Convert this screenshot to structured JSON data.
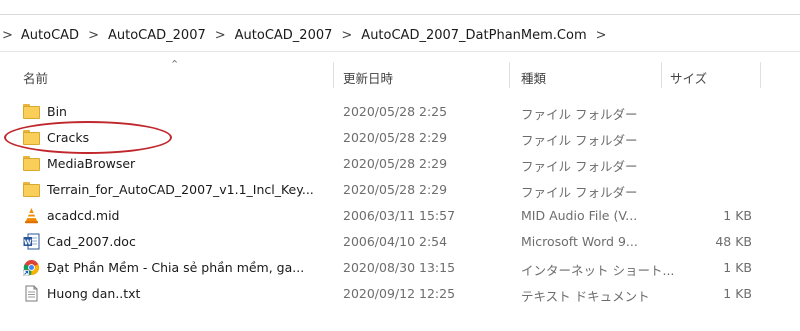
{
  "breadcrumb": {
    "items": [
      "AutoCAD",
      "AutoCAD_2007",
      "AutoCAD_2007",
      "AutoCAD_2007_DatPhanMem.Com"
    ]
  },
  "columns": {
    "name": "名前",
    "date": "更新日時",
    "type": "種類",
    "size": "サイズ"
  },
  "files": [
    {
      "name": "Bin",
      "date": "2020/05/28 2:25",
      "type": "ファイル フォルダー",
      "size": "",
      "icon": "folder-icon"
    },
    {
      "name": "Cracks",
      "date": "2020/05/28 2:29",
      "type": "ファイル フォルダー",
      "size": "",
      "icon": "folder-icon"
    },
    {
      "name": "MediaBrowser",
      "date": "2020/05/28 2:29",
      "type": "ファイル フォルダー",
      "size": "",
      "icon": "folder-icon"
    },
    {
      "name": "Terrain_for_AutoCAD_2007_v1.1_Incl_Key...",
      "date": "2020/05/28 2:29",
      "type": "ファイル フォルダー",
      "size": "",
      "icon": "folder-icon"
    },
    {
      "name": "acadcd.mid",
      "date": "2006/03/11 15:57",
      "type": "MID Audio File (V...",
      "size": "1 KB",
      "icon": "vlc-cone-icon"
    },
    {
      "name": "Cad_2007.doc",
      "date": "2006/04/10 2:54",
      "type": "Microsoft Word 9...",
      "size": "48 KB",
      "icon": "word-document-icon"
    },
    {
      "name": "Đạt Phần Mềm - Chia sẻ phần mềm, ga...",
      "date": "2020/08/30 13:15",
      "type": "インターネット ショート...",
      "size": "1 KB",
      "icon": "chrome-shortcut-icon"
    },
    {
      "name": "Huong dan..txt",
      "date": "2020/09/12 12:25",
      "type": "テキスト ドキュメント",
      "size": "1 KB",
      "icon": "text-file-icon"
    }
  ],
  "annotation": {
    "color": "#c0272d"
  }
}
